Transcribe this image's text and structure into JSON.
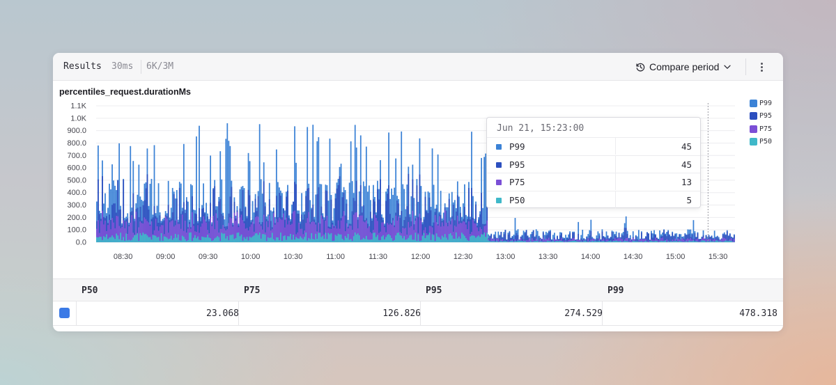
{
  "header": {
    "title": "Results",
    "duration": "30ms",
    "rows": "6K/3M",
    "compare_label": "Compare period",
    "history_icon": "history-icon",
    "chevron_icon": "chevron-down-icon",
    "menu_icon": "kebab-menu-icon"
  },
  "chart_data": {
    "type": "bar",
    "title": "percentiles_request.durationMs",
    "x_ticks": [
      "08:30",
      "09:00",
      "09:30",
      "10:00",
      "10:30",
      "11:00",
      "11:30",
      "12:00",
      "12:30",
      "13:00",
      "13:30",
      "14:00",
      "14:30",
      "15:00",
      "15:30"
    ],
    "y_ticks": [
      "0.0",
      "100.0",
      "200.0",
      "300.0",
      "400.0",
      "500.0",
      "600.0",
      "700.0",
      "800.0",
      "900.0",
      "1.0K",
      "1.1K"
    ],
    "ylim": [
      0,
      1100
    ],
    "xlim": [
      "08:11",
      "15:42"
    ],
    "grid": true,
    "stacked": false,
    "legend_position": "right",
    "series": [
      {
        "name": "P99",
        "color": "#3b82d6",
        "approx_range_before_12:48": [
          150,
          960
        ],
        "approx_range_after_12:48": [
          20,
          210
        ]
      },
      {
        "name": "P95",
        "color": "#2c4fbf",
        "approx_range_before_12:48": [
          120,
          560
        ],
        "approx_range_after_12:48": [
          15,
          120
        ]
      },
      {
        "name": "P75",
        "color": "#7b4fd6",
        "approx_range_before_12:48": [
          60,
          260
        ],
        "approx_range_after_12:48": [
          8,
          40
        ]
      },
      {
        "name": "P50",
        "color": "#3fb8c9",
        "approx_range_before_12:48": [
          10,
          80
        ],
        "approx_range_after_12:48": [
          2,
          15
        ]
      }
    ],
    "cursor_x": "15:23",
    "tooltip": {
      "title": "Jun 21, 15:23:00",
      "rows": [
        {
          "name": "P99",
          "value": "45",
          "color": "#3b82d6"
        },
        {
          "name": "P95",
          "value": "45",
          "color": "#2c4fbf"
        },
        {
          "name": "P75",
          "value": "13",
          "color": "#7b4fd6"
        },
        {
          "name": "P50",
          "value": "5",
          "color": "#3fb8c9"
        }
      ]
    }
  },
  "table": {
    "columns": [
      "P50",
      "P75",
      "P95",
      "P99"
    ],
    "row": [
      "23.068",
      "126.826",
      "274.529",
      "478.318"
    ],
    "swatch_color": "#3b7ae6"
  }
}
